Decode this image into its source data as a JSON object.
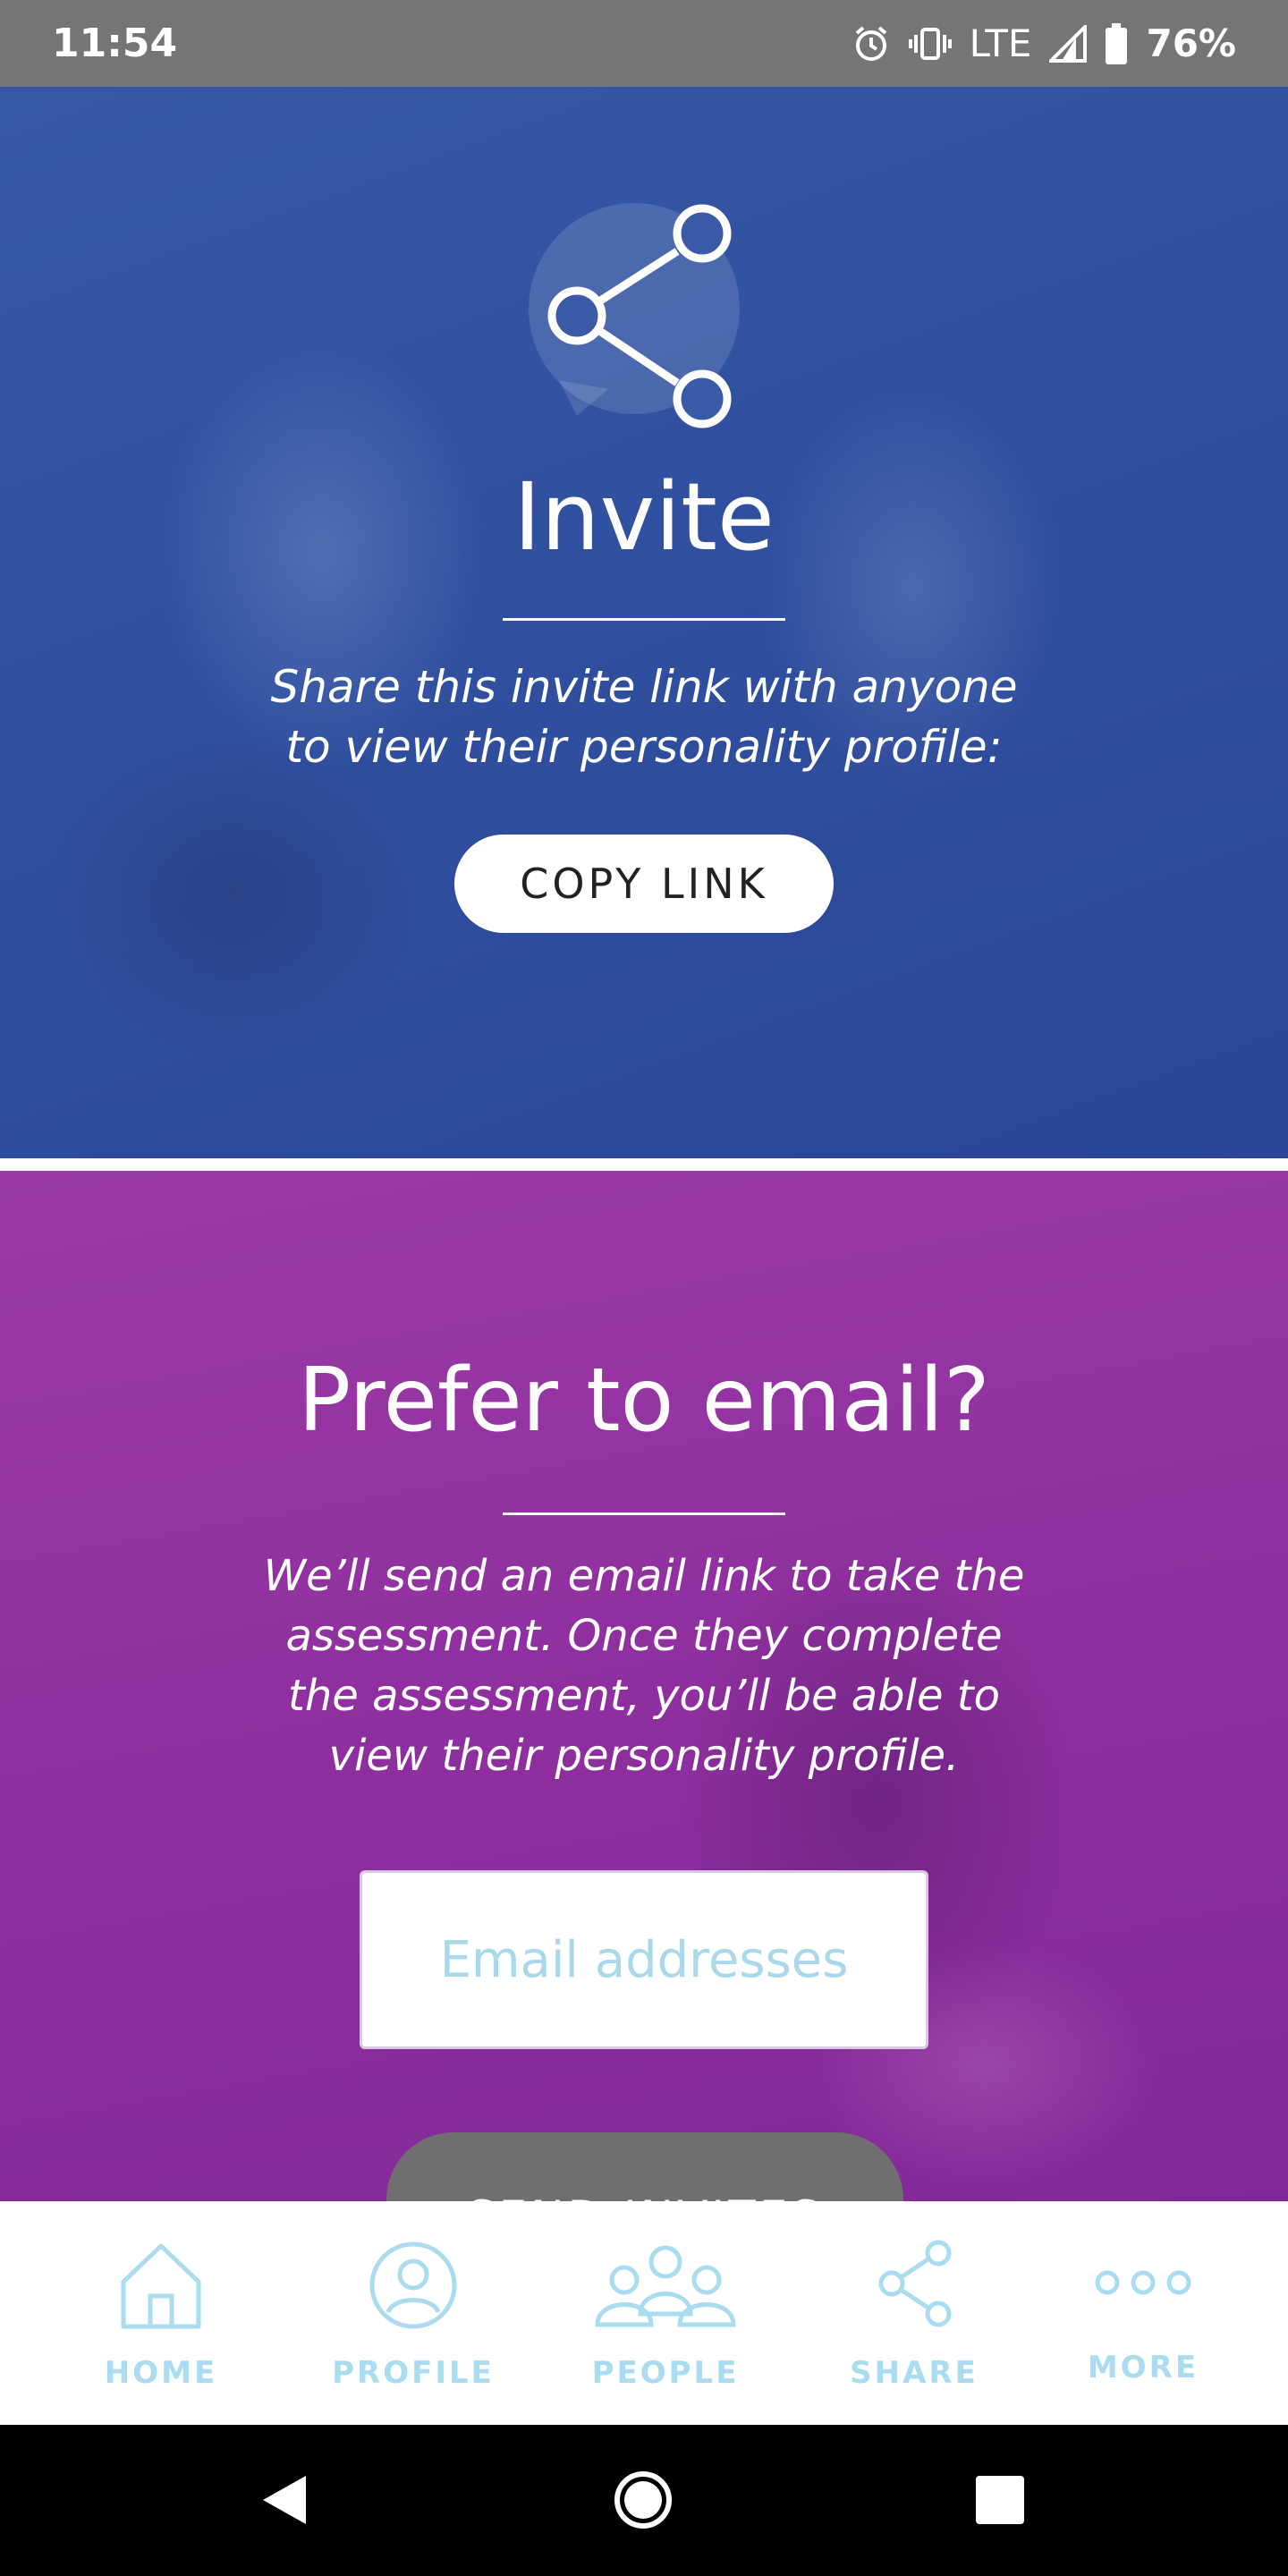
{
  "status_bar": {
    "time": "11:54",
    "network": "LTE",
    "battery": "76%",
    "icons": [
      "alarm-icon",
      "vibrate-icon",
      "signal-icon",
      "battery-icon"
    ]
  },
  "invite": {
    "icon": "share-icon",
    "title": "Invite",
    "description": "Share this invite link with anyone to view their personality profile:",
    "copy_link_label": "COPY LINK"
  },
  "email": {
    "title": "Prefer to email?",
    "description": "We’ll send an email link to take the assessment. Once they complete the assessment, you’ll be able to view their personality profile.",
    "input_placeholder": "Email addresses",
    "send_label": "SEND INVITES"
  },
  "bottom_nav": {
    "items": [
      {
        "label": "HOME",
        "icon": "home-icon"
      },
      {
        "label": "PROFILE",
        "icon": "profile-icon"
      },
      {
        "label": "PEOPLE",
        "icon": "people-icon"
      },
      {
        "label": "SHARE",
        "icon": "share-icon"
      },
      {
        "label": "MORE",
        "icon": "more-icon"
      }
    ]
  },
  "system_nav": {
    "icons": [
      "back-icon",
      "home-circle-icon",
      "recents-icon"
    ]
  },
  "colors": {
    "invite_bg": "#30509f",
    "email_bg": "#8f2f9f",
    "nav_accent": "#a9dcf0",
    "send_button": "#6f6f6f"
  }
}
